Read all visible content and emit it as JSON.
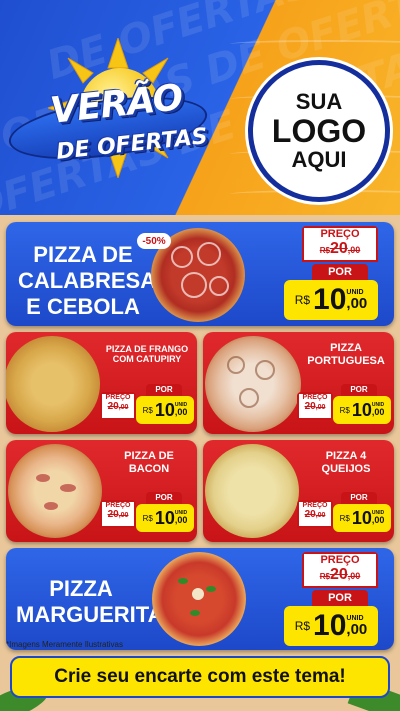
{
  "header": {
    "title_line1": "VERÃO",
    "title_line2": "DE OFERTAS",
    "logo_line1": "SUA",
    "logo_line2": "LOGO",
    "logo_line3": "AQUI"
  },
  "labels": {
    "preco": "PREÇO",
    "por": "POR",
    "unid": "UNID",
    "currency": "R$"
  },
  "products": [
    {
      "name_l1": "PIZZA DE",
      "name_l2": "CALABRESA",
      "name_l3": "E CEBOLA",
      "discount": "-50%",
      "old_int": "20",
      "old_cents": ",00",
      "new_int": "10",
      "new_cents": ",00"
    },
    {
      "name_l1": "PIZZA DE FRANGO",
      "name_l2": "COM CATUPIRY",
      "old_int": "20",
      "old_cents": ",00",
      "new_int": "10",
      "new_cents": ",00"
    },
    {
      "name_l1": "PIZZA",
      "name_l2": "PORTUGUESA",
      "old_int": "20",
      "old_cents": ",00",
      "new_int": "10",
      "new_cents": ",00"
    },
    {
      "name_l1": "PIZZA DE",
      "name_l2": "BACON",
      "old_int": "20",
      "old_cents": ",00",
      "new_int": "10",
      "new_cents": ",00"
    },
    {
      "name_l1": "PIZZA 4",
      "name_l2": "QUEIJOS",
      "old_int": "20",
      "old_cents": ",00",
      "new_int": "10",
      "new_cents": ",00"
    },
    {
      "name_l1": "PIZZA",
      "name_l2": "MARGUERITA",
      "old_int": "20",
      "old_cents": ",00",
      "new_int": "10",
      "new_cents": ",00"
    }
  ],
  "footer": {
    "note": "*Imagens Meramente Ilustrativas",
    "cta": "Crie seu encarte com este tema!"
  },
  "colors": {
    "blue": "#1d49c9",
    "red": "#c81417",
    "yellow": "#fde500",
    "orange": "#f9b52a"
  }
}
